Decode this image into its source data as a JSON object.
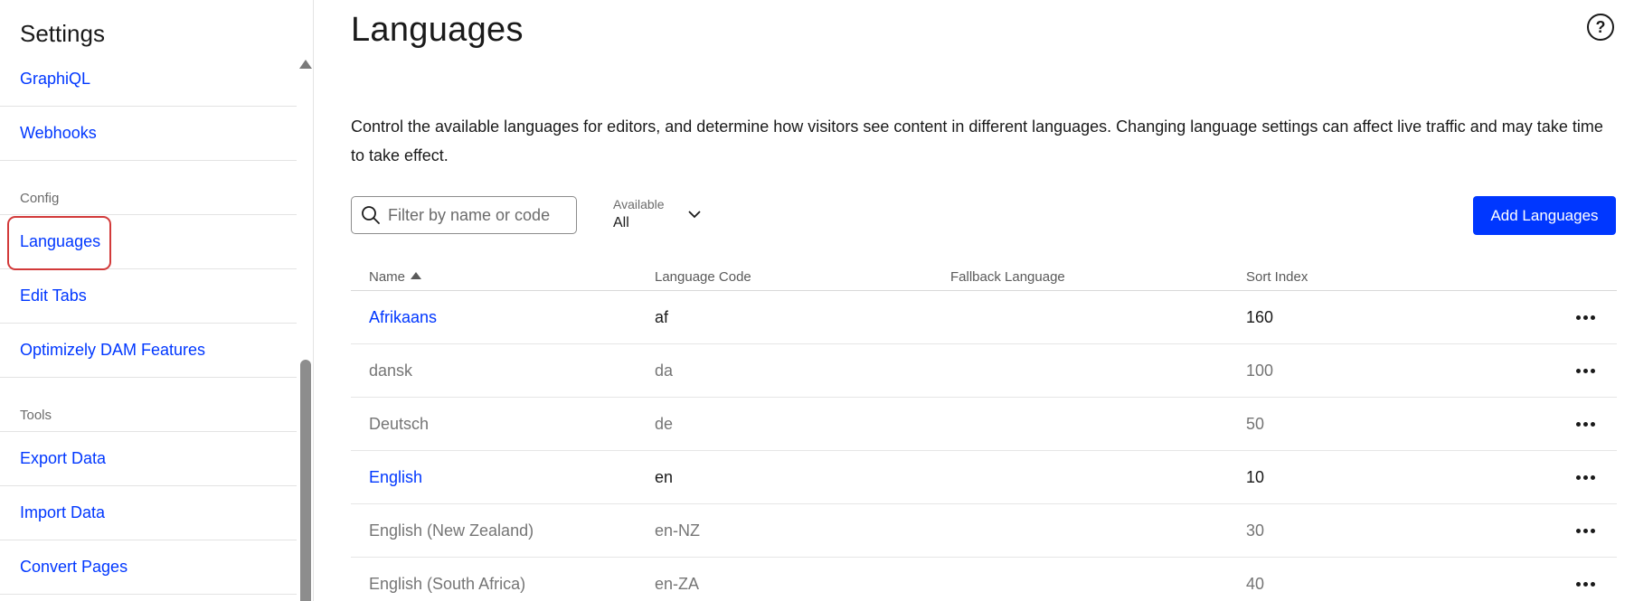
{
  "sidebar": {
    "title": "Settings",
    "items": [
      {
        "type": "link",
        "label": "GraphiQL"
      },
      {
        "type": "link",
        "label": "Webhooks"
      },
      {
        "type": "section",
        "label": "Config"
      },
      {
        "type": "link",
        "label": "Languages"
      },
      {
        "type": "link",
        "label": "Edit Tabs"
      },
      {
        "type": "link",
        "label": "Optimizely DAM Features"
      },
      {
        "type": "section",
        "label": "Tools"
      },
      {
        "type": "link",
        "label": "Export Data"
      },
      {
        "type": "link",
        "label": "Import Data"
      },
      {
        "type": "link",
        "label": "Convert Pages"
      }
    ]
  },
  "main": {
    "title": "Languages",
    "description": "Control the available languages for editors, and determine how visitors see content in different languages. Changing language settings can affect live traffic and may take time to take effect.",
    "filter_placeholder": "Filter by name or code",
    "available_label": "Available",
    "available_value": "All",
    "add_button": "Add Languages",
    "columns": [
      "Name",
      "Language Code",
      "Fallback Language",
      "Sort Index"
    ],
    "rows": [
      {
        "name": "Afrikaans",
        "code": "af",
        "fallback": "",
        "sort": "160",
        "enabled": true
      },
      {
        "name": "dansk",
        "code": "da",
        "fallback": "",
        "sort": "100",
        "enabled": false
      },
      {
        "name": "Deutsch",
        "code": "de",
        "fallback": "",
        "sort": "50",
        "enabled": false
      },
      {
        "name": "English",
        "code": "en",
        "fallback": "",
        "sort": "10",
        "enabled": true
      },
      {
        "name": "English (New Zealand)",
        "code": "en-NZ",
        "fallback": "",
        "sort": "30",
        "enabled": false
      },
      {
        "name": "English (South Africa)",
        "code": "en-ZA",
        "fallback": "",
        "sort": "40",
        "enabled": false
      }
    ]
  },
  "colors": {
    "accent": "#0037ff",
    "highlight": "#d23a3a",
    "disabled_text": "#757575"
  },
  "icons": {
    "help": "question-circle-icon",
    "search": "search-icon",
    "dropdown": "chevron-down-icon",
    "sort": "sort-ascending-icon",
    "more": "more-horizontal-icon"
  }
}
